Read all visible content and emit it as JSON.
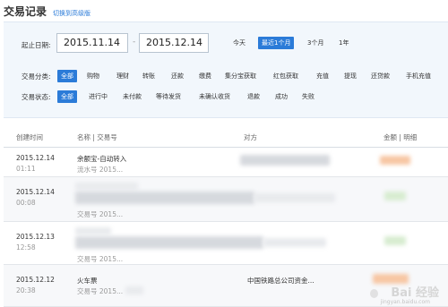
{
  "header": {
    "title": "交易记录",
    "switch_link": "切换到高级版"
  },
  "filters": {
    "date_label": "起止日期:",
    "start_date": "2015.11.14",
    "end_date": "2015.12.14",
    "separator": "-",
    "quick_ranges": [
      "今天",
      "最近1个月",
      "3个月",
      "1年"
    ],
    "selected_range": "最近1个月",
    "category_label": "交易分类:",
    "categories": [
      "全部",
      "购物",
      "理财",
      "转账",
      "还款",
      "缴费",
      "集分宝获取",
      "红包获取",
      "充值",
      "提现",
      "还贷款",
      "手机充值"
    ],
    "status_label": "交易状态:",
    "statuses": [
      "全部",
      "进行中",
      "未付款",
      "等待发货",
      "未确认收货",
      "退款",
      "成功",
      "失败"
    ]
  },
  "table": {
    "headers": {
      "created": "创建时间",
      "name": "名称 | 交易号",
      "counterparty": "对方",
      "amount": "金额 | 明细"
    },
    "rows": [
      {
        "date": "2015.12.14",
        "time": "01:11",
        "name": "余额宝-自动转入",
        "serial": "流水号 2015..."
      },
      {
        "date": "2015.12.14",
        "time": "00:08",
        "name": "",
        "serial": "交易号 2015..."
      },
      {
        "date": "2015.12.13",
        "time": "12:58",
        "name": "",
        "serial": "交易号 2015..."
      },
      {
        "date": "2015.12.12",
        "time": "20:38",
        "name": "火车票",
        "serial": "交易号 2015...",
        "counterparty": "中国铁路总公司资金..."
      }
    ]
  },
  "watermark": {
    "text": "Bai 经验",
    "sub": "jingyan.baidu.com"
  },
  "colors": {
    "accent": "#2b7bd8",
    "panel_bg": "#f2f7fc",
    "amount_orange": "#f08c2a"
  }
}
